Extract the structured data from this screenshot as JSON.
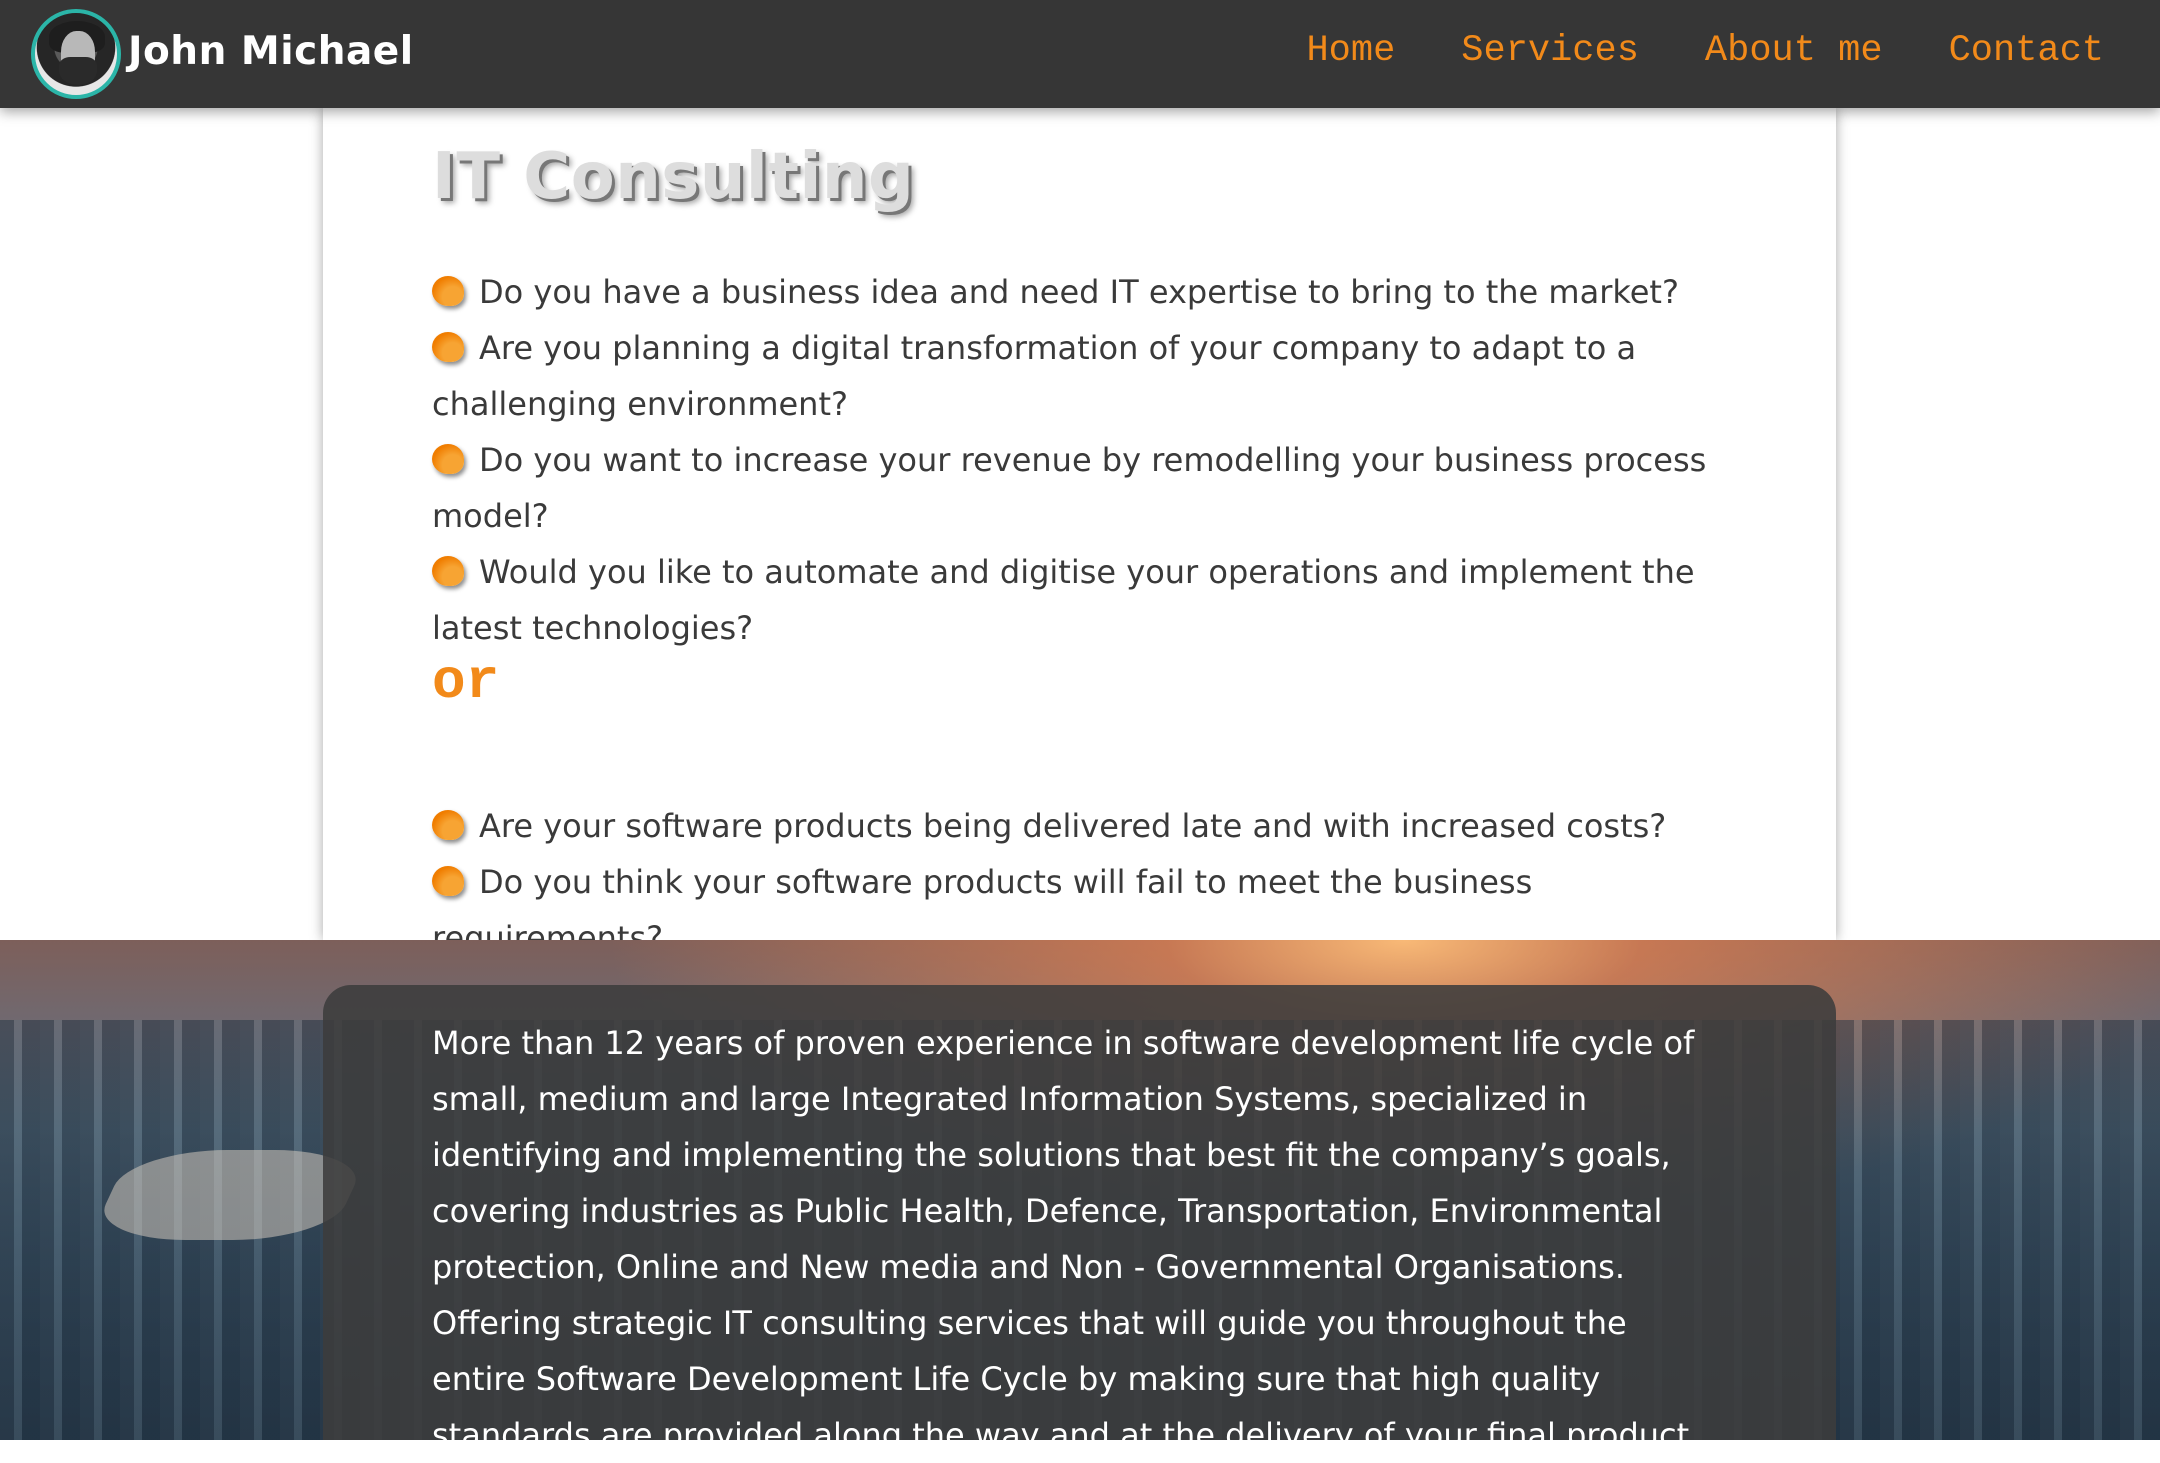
{
  "navbar": {
    "brand": "John Michael",
    "links": [
      "Home",
      "Services",
      "About me",
      "Contact"
    ]
  },
  "main": {
    "title": "IT Consulting",
    "questions_group1": [
      "Do you have a business idea and need IT expertise to bring to the market?",
      "Are you planning a digital transformation of your company to adapt to a challenging environment?",
      "Do you want to increase your revenue by remodelling your business process model?",
      "Would you like to automate and digitise your operations and implement the latest technologies?"
    ],
    "separator": "or",
    "questions_group2": [
      "Are your software products being delivered late and with increased costs?",
      "Do you think your software products will fail to meet the business requirements?"
    ]
  },
  "hero": {
    "paragraph1": "More than 12 years of proven experience in software development life cycle of small, medium and large Integrated Information Systems, specialized in identifying and implementing the solutions that best fit the company’s goals, covering industries as Public Health, Defence, Transportation, Environmental protection, Online and New media and Non - Governmental Organisations.",
    "paragraph2": "Offering strategic IT consulting services that will guide you throughout the entire Software Development Life Cycle by making sure that high quality standards are provided along the way and at the delivery of your final product."
  },
  "colors": {
    "accent": "#f28a1a",
    "navbar_bg": "#363636",
    "avatar_ring": "#2bb5a8"
  }
}
